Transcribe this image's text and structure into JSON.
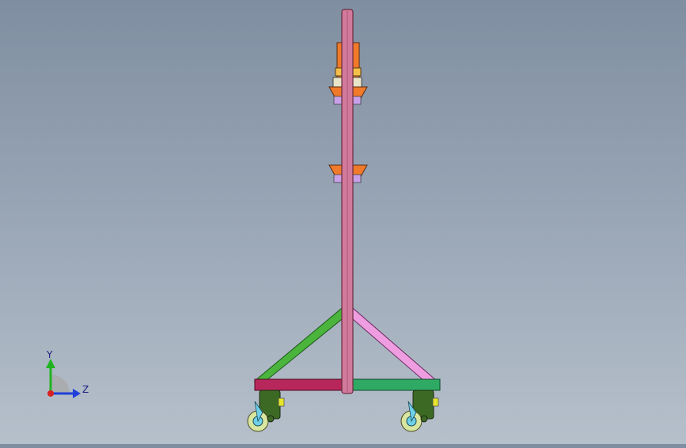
{
  "triad": {
    "y_label": "Y",
    "z_label": "Z",
    "colors": {
      "y": "#1fb41f",
      "z": "#1f3fd8",
      "x": "#d81f1f"
    }
  },
  "model": {
    "colors": {
      "mast": "#d27a9b",
      "mast_edge": "#6a2a40",
      "brace_left": "#4ab43c",
      "brace_right": "#ee9ee0",
      "base_left": "#b8275c",
      "base_right": "#2faa64",
      "bracket": "#f07a2a",
      "caster_body": "#3c6a24",
      "caster_wheel": "#d8e6a0",
      "caster_hub": "#6fd0e8",
      "pin": "#e6e62a"
    }
  }
}
